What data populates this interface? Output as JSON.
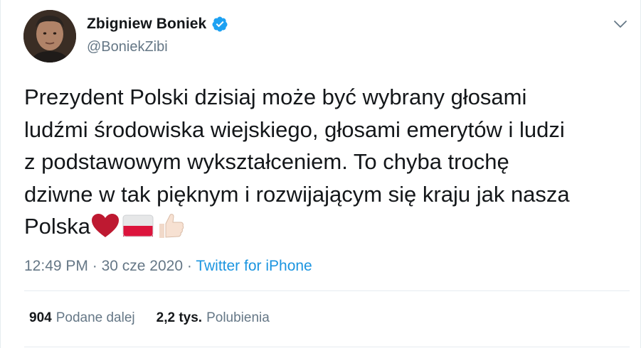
{
  "author": {
    "display_name": "Zbigniew Boniek",
    "handle": "@BoniekZibi",
    "verified": true
  },
  "icons": {
    "avatar": "profile-photo",
    "verified": "verified-badge-icon",
    "menu": "chevron-down-icon",
    "emojis": [
      "red-heart-icon",
      "poland-flag-icon",
      "thumbs-up-icon"
    ]
  },
  "tweet": {
    "text": "Prezydent Polski dzisiaj może być wybrany głosami\nludźmi środowiska wiejskiego, głosami emerytów i ludzi\nz podstawowym wykształceniem. To chyba trochę\ndziwne w tak pięknym i rozwijającym się kraju jak nasza\nPolska"
  },
  "meta": {
    "time": "12:49 PM",
    "separator": "·",
    "date": "30 cze 2020",
    "separator2": "·",
    "source": "Twitter for iPhone"
  },
  "stats": {
    "retweets_count": "904",
    "retweets_label": "Podane dalej",
    "likes_count": "2,2 tys.",
    "likes_label": "Polubienia"
  },
  "colors": {
    "text": "#14171a",
    "secondary": "#657786",
    "link": "#1b95e0",
    "verified": "#1da1f2",
    "border": "#e6ecf0"
  }
}
